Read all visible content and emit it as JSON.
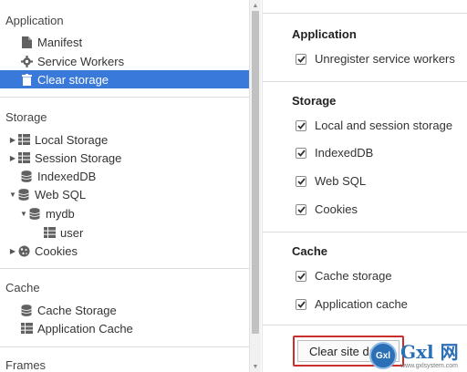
{
  "sidebar": {
    "application": {
      "title": "Application",
      "items": [
        {
          "label": "Manifest",
          "icon": "file-icon"
        },
        {
          "label": "Service Workers",
          "icon": "gear-icon"
        },
        {
          "label": "Clear storage",
          "icon": "trash-icon"
        }
      ]
    },
    "storage": {
      "title": "Storage",
      "items": [
        {
          "label": "Local Storage",
          "icon": "grid-icon"
        },
        {
          "label": "Session Storage",
          "icon": "grid-icon"
        },
        {
          "label": "IndexedDB",
          "icon": "database-icon"
        },
        {
          "label": "Web SQL",
          "icon": "database-icon"
        },
        {
          "label": "mydb",
          "icon": "database-icon"
        },
        {
          "label": "user",
          "icon": "grid-icon"
        },
        {
          "label": "Cookies",
          "icon": "cookie-icon"
        }
      ]
    },
    "cache": {
      "title": "Cache",
      "items": [
        {
          "label": "Cache Storage",
          "icon": "database-icon"
        },
        {
          "label": "Application Cache",
          "icon": "grid-icon"
        }
      ]
    },
    "frames": {
      "title": "Frames"
    }
  },
  "panel": {
    "application": {
      "heading": "Application",
      "options": [
        {
          "label": "Unregister service workers",
          "checked": true
        }
      ]
    },
    "storage": {
      "heading": "Storage",
      "options": [
        {
          "label": "Local and session storage",
          "checked": true
        },
        {
          "label": "IndexedDB",
          "checked": true
        },
        {
          "label": "Web SQL",
          "checked": true
        },
        {
          "label": "Cookies",
          "checked": true
        }
      ]
    },
    "cache": {
      "heading": "Cache",
      "options": [
        {
          "label": "Cache storage",
          "checked": true
        },
        {
          "label": "Application cache",
          "checked": true
        }
      ]
    },
    "clear_button": "Clear site da"
  },
  "watermark": {
    "logo": "Gxl",
    "brand": "Gxl 网",
    "site": "www.gxlsystem.com"
  },
  "colors": {
    "selected": "#3879d9",
    "highlight_border": "#c9302c"
  }
}
